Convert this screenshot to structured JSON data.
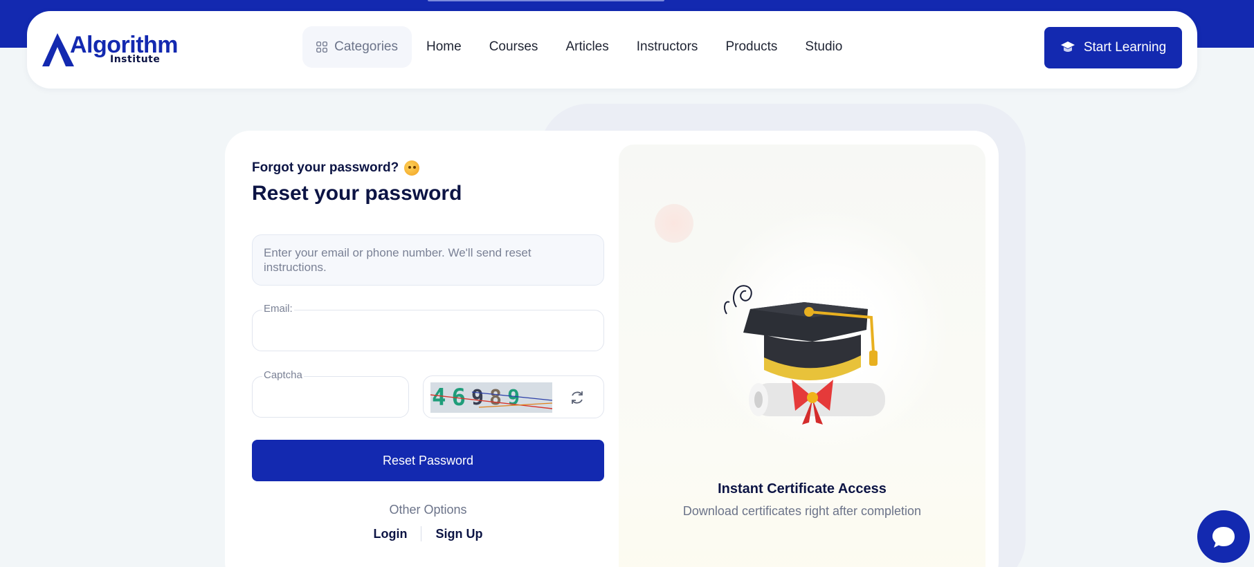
{
  "brand": {
    "name": "Algorithm",
    "tagline": "Institute",
    "color": "#1329b0"
  },
  "nav": {
    "categories_label": "Categories",
    "items": [
      "Home",
      "Courses",
      "Articles",
      "Instructors",
      "Products",
      "Studio"
    ]
  },
  "header": {
    "cta_label": "Start Learning"
  },
  "form": {
    "eyebrow": "Forgot your password?",
    "title": "Reset your password",
    "info": "Enter your email or phone number. We'll send reset instructions.",
    "email_label": "Email:",
    "email_value": "",
    "captcha_label": "Captcha",
    "captcha_value": "",
    "captcha_code": [
      "4",
      "6",
      "9",
      "8",
      "9"
    ],
    "submit_label": "Reset Password",
    "other_options": "Other Options",
    "login_label": "Login",
    "signup_label": "Sign Up"
  },
  "feature": {
    "title": "Instant Certificate Access",
    "subtitle": "Download certificates right after completion"
  },
  "icons": {
    "categories": "grid-icon",
    "cta": "graduation-cap-icon",
    "refresh": "refresh-icon",
    "chat": "chat-icon"
  }
}
